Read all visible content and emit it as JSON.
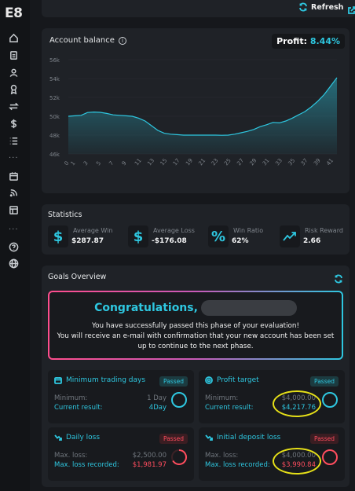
{
  "app": {
    "logo": "E8"
  },
  "topbar": {
    "refresh_label": "Refresh"
  },
  "balance": {
    "title": "Account balance",
    "profit_label": "Profit:",
    "profit_value": "8.44%"
  },
  "chart_data": {
    "type": "area",
    "title": "Account balance",
    "ylim": [
      46000,
      56000
    ],
    "y_ticks": [
      "56k",
      "54k",
      "52k",
      "50k",
      "48k",
      "46k"
    ],
    "x_ticks": [
      "0",
      "1",
      "3",
      "5",
      "7",
      "9",
      "11",
      "13",
      "15",
      "17",
      "19",
      "21",
      "23",
      "25",
      "27",
      "29",
      "31",
      "33",
      "35",
      "37",
      "39",
      "41"
    ],
    "x": [
      0,
      1,
      2,
      3,
      4,
      5,
      6,
      7,
      8,
      9,
      10,
      11,
      12,
      13,
      14,
      15,
      16,
      17,
      18,
      19,
      20,
      21,
      22,
      23,
      24,
      25,
      26,
      27,
      28,
      29,
      30,
      31,
      32,
      33,
      34,
      35,
      36,
      37,
      38,
      39,
      40,
      41,
      42
    ],
    "values": [
      50000,
      50050,
      50100,
      50400,
      50450,
      50420,
      50300,
      50150,
      50100,
      50050,
      50000,
      49800,
      49500,
      49000,
      48500,
      48200,
      48100,
      48050,
      48000,
      48000,
      48000,
      48000,
      48000,
      48000,
      47980,
      48000,
      48100,
      48250,
      48400,
      48600,
      48900,
      49100,
      49350,
      49300,
      49500,
      49800,
      50150,
      50500,
      51000,
      51600,
      52300,
      53200,
      54100
    ],
    "color": "#2ec7e0"
  },
  "statistics": {
    "title": "Statistics",
    "items": [
      {
        "label": "Average Win",
        "value": "$287.87",
        "icon": "$"
      },
      {
        "label": "Average Loss",
        "value": "-$176.08",
        "icon": "$"
      },
      {
        "label": "Win Ratio",
        "value": "62%",
        "icon": "%"
      },
      {
        "label": "Risk Reward",
        "value": "2.66",
        "icon": "trend-up"
      }
    ]
  },
  "goals": {
    "title": "Goals Overview",
    "congrats_title": "Congratulations,",
    "congrats_line1": "You have successfully passed this phase of your evaluation!",
    "congrats_line2": "You will receive an e-mail with confirmation that your new account has been set",
    "congrats_line3": "up to continue to the next phase.",
    "cards": [
      {
        "title": "Minimum trading days",
        "badge": "Passed",
        "row1_label": "Minimum:",
        "row1_value": "1 Day",
        "row2_label": "Current result:",
        "row2_value": "4Day"
      },
      {
        "title": "Profit target",
        "badge": "Passed",
        "row1_label": "Minimum:",
        "row1_value": "$4,000.00",
        "row2_label": "Current result:",
        "row2_value": "$4,217.76"
      },
      {
        "title": "Daily loss",
        "badge": "Passed",
        "row1_label": "Max. loss:",
        "row1_value": "$2,500.00",
        "row2_label": "Max. loss recorded:",
        "row2_value": "$1,981.97"
      },
      {
        "title": "Initial deposit loss",
        "badge": "Passed",
        "row1_label": "Max. loss:",
        "row1_value": "$4,000.00",
        "row2_label": "Max. loss recorded:",
        "row2_value": "$3,990.84"
      }
    ]
  }
}
